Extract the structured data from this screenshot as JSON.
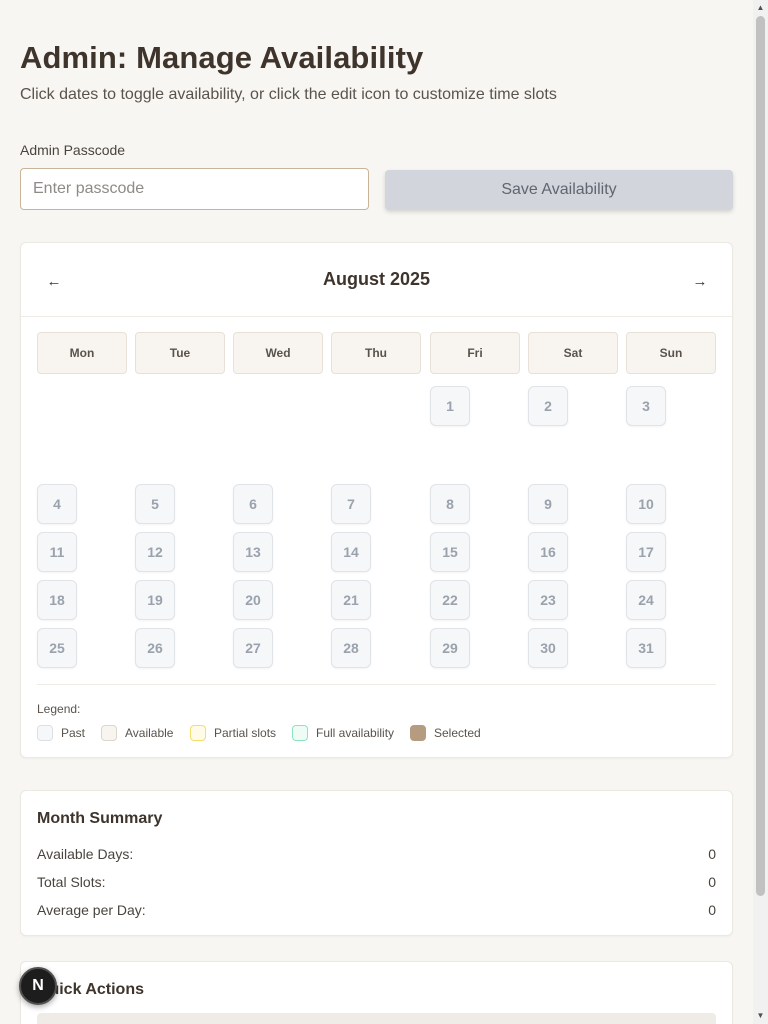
{
  "header": {
    "title": "Admin: Manage Availability",
    "subtitle": "Click dates to toggle availability, or click the edit icon to customize time slots"
  },
  "passcode": {
    "label": "Admin Passcode",
    "placeholder": "Enter passcode",
    "value": ""
  },
  "save_button": {
    "label": "Save Availability"
  },
  "calendar": {
    "month_title": "August 2025",
    "prev_label": "←",
    "next_label": "→",
    "weekdays": [
      "Mon",
      "Tue",
      "Wed",
      "Thu",
      "Fri",
      "Sat",
      "Sun"
    ],
    "days": [
      "1",
      "2",
      "3",
      "4",
      "5",
      "6",
      "7",
      "8",
      "9",
      "10",
      "11",
      "12",
      "13",
      "14",
      "15",
      "16",
      "17",
      "18",
      "19",
      "20",
      "21",
      "22",
      "23",
      "24",
      "25",
      "26",
      "27",
      "28",
      "29",
      "30",
      "31"
    ]
  },
  "legend": {
    "title": "Legend:",
    "items": [
      {
        "label": "Past",
        "fill": "#f6f7f9",
        "border": "#dcdfe4"
      },
      {
        "label": "Available",
        "fill": "#f8f5f0",
        "border": "#ddd6cc"
      },
      {
        "label": "Partial slots",
        "fill": "#fffbe6",
        "border": "#f3dd6c"
      },
      {
        "label": "Full availability",
        "fill": "#eefcf5",
        "border": "#8ee3bd"
      },
      {
        "label": "Selected",
        "fill": "#b59c80",
        "border": "#b59c80"
      }
    ]
  },
  "summary": {
    "title": "Month Summary",
    "rows": [
      {
        "label": "Available Days:",
        "value": "0"
      },
      {
        "label": "Total Slots:",
        "value": "0"
      },
      {
        "label": "Average per Day:",
        "value": "0"
      }
    ]
  },
  "quick_actions": {
    "title": "Quick Actions"
  },
  "fab": {
    "label": "N"
  },
  "scrollbar": {
    "up": "▲",
    "down": "▼"
  }
}
